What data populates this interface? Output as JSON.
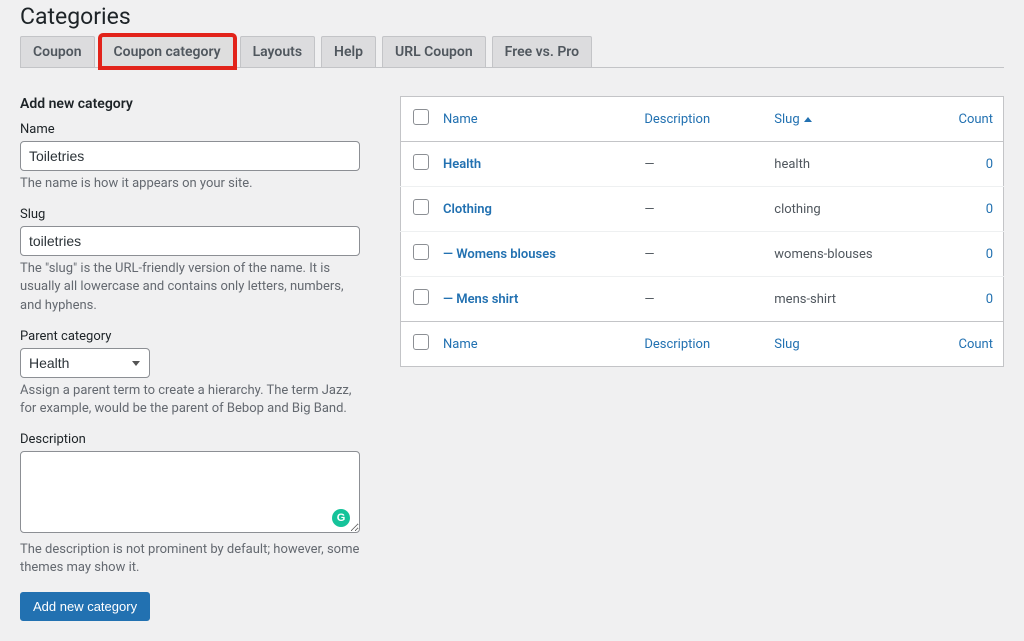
{
  "page_title": "Categories",
  "tabs": [
    {
      "label": "Coupon"
    },
    {
      "label": "Coupon category"
    },
    {
      "label": "Layouts"
    },
    {
      "label": "Help"
    },
    {
      "label": "URL Coupon"
    },
    {
      "label": "Free vs. Pro"
    }
  ],
  "form": {
    "heading": "Add new category",
    "name_label": "Name",
    "name_value": "Toiletries",
    "name_hint": "The name is how it appears on your site.",
    "slug_label": "Slug",
    "slug_value": "toiletries",
    "slug_hint": "The \"slug\" is the URL-friendly version of the name. It is usually all lowercase and contains only letters, numbers, and hyphens.",
    "parent_label": "Parent category",
    "parent_value": "Health",
    "parent_hint": "Assign a parent term to create a hierarchy. The term Jazz, for example, would be the parent of Bebop and Big Band.",
    "desc_label": "Description",
    "desc_value": "",
    "desc_hint": "The description is not prominent by default; however, some themes may show it.",
    "submit_label": "Add new category"
  },
  "table": {
    "headers": {
      "name": "Name",
      "description": "Description",
      "slug": "Slug",
      "count": "Count"
    },
    "rows": [
      {
        "name": "Health",
        "description": "—",
        "slug": "health",
        "count": "0"
      },
      {
        "name": "Clothing",
        "description": "—",
        "slug": "clothing",
        "count": "0"
      },
      {
        "name": "— Womens blouses",
        "description": "—",
        "slug": "womens-blouses",
        "count": "0"
      },
      {
        "name": "— Mens shirt",
        "description": "—",
        "slug": "mens-shirt",
        "count": "0"
      }
    ]
  }
}
